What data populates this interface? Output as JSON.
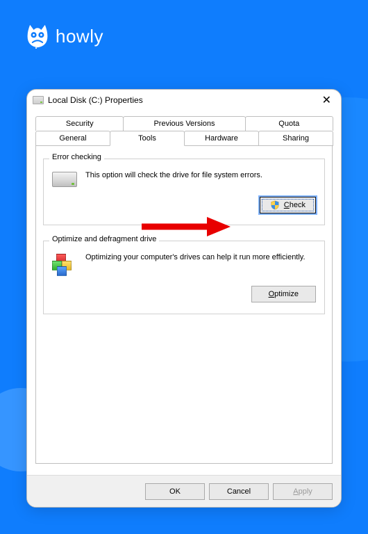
{
  "brand": {
    "name": "howly"
  },
  "dialog": {
    "title": "Local Disk (C:) Properties",
    "tabs_top": [
      "Security",
      "Previous Versions",
      "Quota"
    ],
    "tabs_bottom": [
      "General",
      "Tools",
      "Hardware",
      "Sharing"
    ],
    "active_tab": "Tools"
  },
  "error_checking": {
    "title": "Error checking",
    "text": "This option will check the drive for file system errors.",
    "button_label": "Check",
    "button_underline": "C"
  },
  "optimize": {
    "title": "Optimize and defragment drive",
    "text": "Optimizing your computer's drives can help it run more efficiently.",
    "button_label": "Optimize",
    "button_underline": "O"
  },
  "footer": {
    "ok": "OK",
    "cancel": "Cancel",
    "apply": "Apply",
    "apply_underline": "A"
  }
}
